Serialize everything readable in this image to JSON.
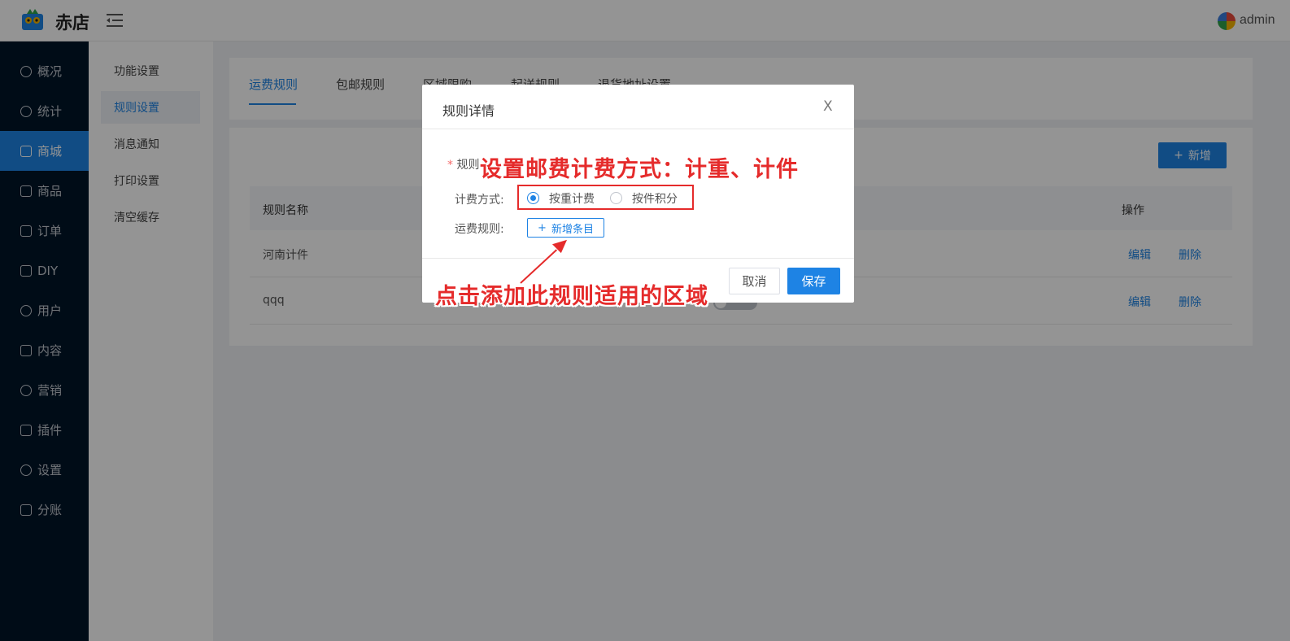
{
  "header": {
    "logo_text": "赤店",
    "user_name": "admin"
  },
  "sidebar": {
    "items": [
      {
        "label": "概况",
        "icon": "dashboard-icon"
      },
      {
        "label": "统计",
        "icon": "chart-icon"
      },
      {
        "label": "商城",
        "icon": "shop-icon",
        "active": true
      },
      {
        "label": "商品",
        "icon": "goods-icon"
      },
      {
        "label": "订单",
        "icon": "order-icon"
      },
      {
        "label": "DIY",
        "icon": "diy-icon"
      },
      {
        "label": "用户",
        "icon": "user-icon"
      },
      {
        "label": "内容",
        "icon": "content-icon"
      },
      {
        "label": "营销",
        "icon": "marketing-icon"
      },
      {
        "label": "插件",
        "icon": "plugin-icon"
      },
      {
        "label": "设置",
        "icon": "settings-icon"
      },
      {
        "label": "分账",
        "icon": "split-icon"
      }
    ]
  },
  "submenu": {
    "items": [
      {
        "label": "功能设置"
      },
      {
        "label": "规则设置",
        "active": true
      },
      {
        "label": "消息通知"
      },
      {
        "label": "打印设置"
      },
      {
        "label": "清空缓存"
      }
    ]
  },
  "tabs": [
    "运费规则",
    "包邮规则",
    "区域限购",
    "起送规则",
    "退货地址设置"
  ],
  "table": {
    "add_button": "新增",
    "headers": {
      "name": "规则名称",
      "action": "操作"
    },
    "rows": [
      {
        "name": "河南计件",
        "edit": "编辑",
        "delete": "删除"
      },
      {
        "name": "qqq",
        "edit": "编辑",
        "delete": "删除"
      }
    ]
  },
  "modal": {
    "title": "规则详情",
    "close": "X",
    "rule_name_label": "规则",
    "billing_label": "计费方式:",
    "billing_options": [
      "按重计费",
      "按件积分"
    ],
    "billing_selected": 0,
    "shipping_rule_label": "运费规则:",
    "new_item_button": "新增条目",
    "cancel": "取消",
    "save": "保存"
  },
  "annotations": {
    "top": "设置邮费计费方式：计重、计件",
    "bottom": "点击添加此规则适用的区域"
  },
  "colors": {
    "primary": "#1e83e4",
    "sidebar_bg": "#001529",
    "annotation": "#e52b2b"
  }
}
